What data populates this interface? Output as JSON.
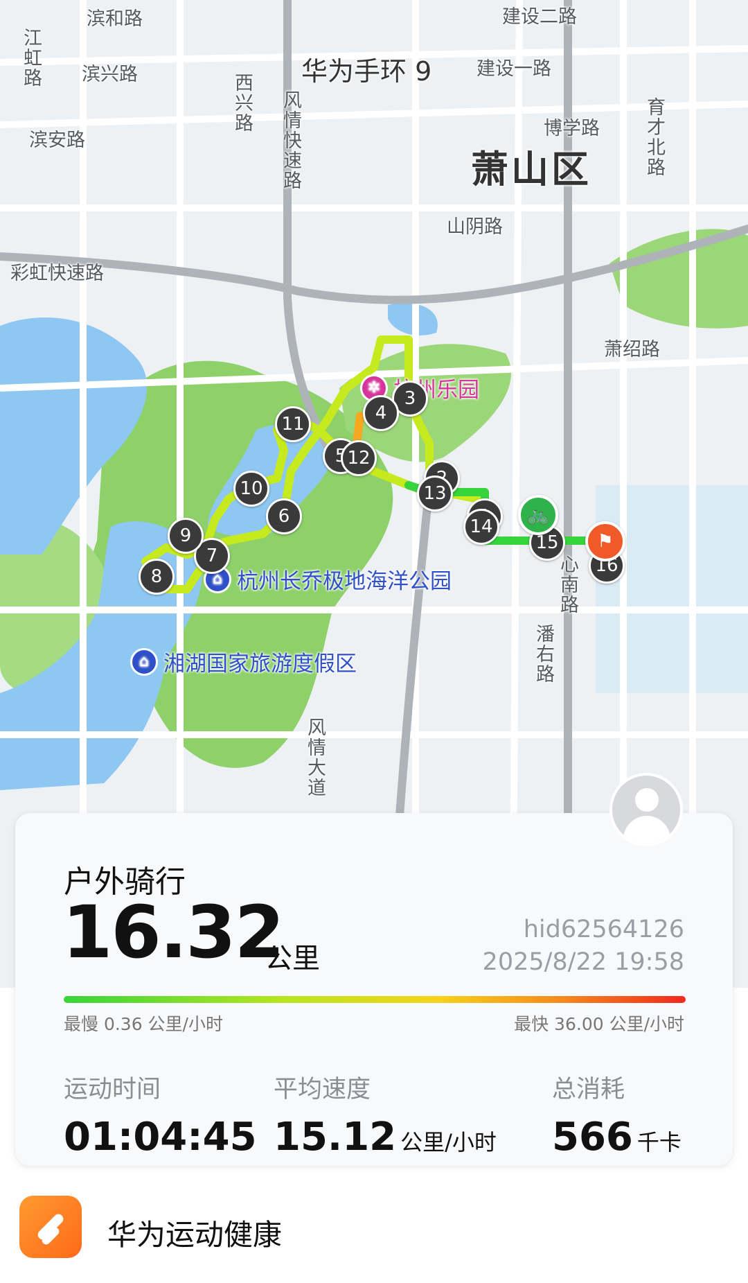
{
  "map": {
    "device_label": "华为手环 9",
    "district": "萧山区",
    "road_labels": [
      "滨和路",
      "滨兴路",
      "滨安路",
      "建设二路",
      "建设一路",
      "博学路",
      "育才北路",
      "西兴路",
      "风情快速路",
      "江虹路",
      "彩虹快速路",
      "山阴路",
      "萧绍路",
      "心南路",
      "潘右路",
      "风情大道"
    ],
    "pois": [
      {
        "name": "杭州乐园",
        "color": "#d6369c",
        "icon": "ferris-wheel-icon"
      },
      {
        "name": "杭州长乔极地海洋公园",
        "color": "#2f50c8",
        "icon": "landmark-icon"
      },
      {
        "name": "湘湖国家旅游度假区",
        "color": "#2f50c8",
        "icon": "landmark-icon"
      }
    ],
    "km_markers": [
      "1",
      "2",
      "3",
      "4",
      "5",
      "6",
      "7",
      "8",
      "9",
      "10",
      "11",
      "12",
      "13",
      "14",
      "15",
      "16"
    ],
    "start_icon": "bicycle-icon",
    "end_icon": "flag-icon"
  },
  "activity": {
    "title": "户外骑行",
    "distance": "16.32",
    "distance_unit": "公里",
    "user_id": "hid62564126",
    "datetime": "2025/8/22 19:58",
    "speed_min": "最慢 0.36 公里/小时",
    "speed_max": "最快 36.00 公里/小时",
    "stats": [
      {
        "label": "运动时间",
        "value": "01:04:45",
        "unit": ""
      },
      {
        "label": "平均速度",
        "value": "15.12",
        "unit": "公里/小时"
      },
      {
        "label": "总消耗",
        "value": "566",
        "unit": "千卡"
      }
    ]
  },
  "footer": {
    "app_name": "华为运动健康"
  },
  "colors": {
    "route_fast": "#38d43c",
    "route_mid": "#c6ea1e",
    "start": "#2fb24a",
    "end": "#f05a28"
  }
}
